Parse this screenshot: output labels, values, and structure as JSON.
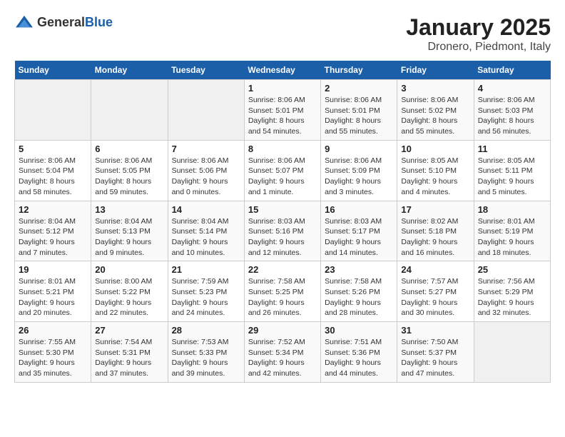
{
  "logo": {
    "text_general": "General",
    "text_blue": "Blue"
  },
  "title": "January 2025",
  "subtitle": "Dronero, Piedmont, Italy",
  "weekdays": [
    "Sunday",
    "Monday",
    "Tuesday",
    "Wednesday",
    "Thursday",
    "Friday",
    "Saturday"
  ],
  "weeks": [
    [
      {
        "day": "",
        "info": ""
      },
      {
        "day": "",
        "info": ""
      },
      {
        "day": "",
        "info": ""
      },
      {
        "day": "1",
        "info": "Sunrise: 8:06 AM\nSunset: 5:01 PM\nDaylight: 8 hours\nand 54 minutes."
      },
      {
        "day": "2",
        "info": "Sunrise: 8:06 AM\nSunset: 5:01 PM\nDaylight: 8 hours\nand 55 minutes."
      },
      {
        "day": "3",
        "info": "Sunrise: 8:06 AM\nSunset: 5:02 PM\nDaylight: 8 hours\nand 55 minutes."
      },
      {
        "day": "4",
        "info": "Sunrise: 8:06 AM\nSunset: 5:03 PM\nDaylight: 8 hours\nand 56 minutes."
      }
    ],
    [
      {
        "day": "5",
        "info": "Sunrise: 8:06 AM\nSunset: 5:04 PM\nDaylight: 8 hours\nand 58 minutes."
      },
      {
        "day": "6",
        "info": "Sunrise: 8:06 AM\nSunset: 5:05 PM\nDaylight: 8 hours\nand 59 minutes."
      },
      {
        "day": "7",
        "info": "Sunrise: 8:06 AM\nSunset: 5:06 PM\nDaylight: 9 hours\nand 0 minutes."
      },
      {
        "day": "8",
        "info": "Sunrise: 8:06 AM\nSunset: 5:07 PM\nDaylight: 9 hours\nand 1 minute."
      },
      {
        "day": "9",
        "info": "Sunrise: 8:06 AM\nSunset: 5:09 PM\nDaylight: 9 hours\nand 3 minutes."
      },
      {
        "day": "10",
        "info": "Sunrise: 8:05 AM\nSunset: 5:10 PM\nDaylight: 9 hours\nand 4 minutes."
      },
      {
        "day": "11",
        "info": "Sunrise: 8:05 AM\nSunset: 5:11 PM\nDaylight: 9 hours\nand 5 minutes."
      }
    ],
    [
      {
        "day": "12",
        "info": "Sunrise: 8:04 AM\nSunset: 5:12 PM\nDaylight: 9 hours\nand 7 minutes."
      },
      {
        "day": "13",
        "info": "Sunrise: 8:04 AM\nSunset: 5:13 PM\nDaylight: 9 hours\nand 9 minutes."
      },
      {
        "day": "14",
        "info": "Sunrise: 8:04 AM\nSunset: 5:14 PM\nDaylight: 9 hours\nand 10 minutes."
      },
      {
        "day": "15",
        "info": "Sunrise: 8:03 AM\nSunset: 5:16 PM\nDaylight: 9 hours\nand 12 minutes."
      },
      {
        "day": "16",
        "info": "Sunrise: 8:03 AM\nSunset: 5:17 PM\nDaylight: 9 hours\nand 14 minutes."
      },
      {
        "day": "17",
        "info": "Sunrise: 8:02 AM\nSunset: 5:18 PM\nDaylight: 9 hours\nand 16 minutes."
      },
      {
        "day": "18",
        "info": "Sunrise: 8:01 AM\nSunset: 5:19 PM\nDaylight: 9 hours\nand 18 minutes."
      }
    ],
    [
      {
        "day": "19",
        "info": "Sunrise: 8:01 AM\nSunset: 5:21 PM\nDaylight: 9 hours\nand 20 minutes."
      },
      {
        "day": "20",
        "info": "Sunrise: 8:00 AM\nSunset: 5:22 PM\nDaylight: 9 hours\nand 22 minutes."
      },
      {
        "day": "21",
        "info": "Sunrise: 7:59 AM\nSunset: 5:23 PM\nDaylight: 9 hours\nand 24 minutes."
      },
      {
        "day": "22",
        "info": "Sunrise: 7:58 AM\nSunset: 5:25 PM\nDaylight: 9 hours\nand 26 minutes."
      },
      {
        "day": "23",
        "info": "Sunrise: 7:58 AM\nSunset: 5:26 PM\nDaylight: 9 hours\nand 28 minutes."
      },
      {
        "day": "24",
        "info": "Sunrise: 7:57 AM\nSunset: 5:27 PM\nDaylight: 9 hours\nand 30 minutes."
      },
      {
        "day": "25",
        "info": "Sunrise: 7:56 AM\nSunset: 5:29 PM\nDaylight: 9 hours\nand 32 minutes."
      }
    ],
    [
      {
        "day": "26",
        "info": "Sunrise: 7:55 AM\nSunset: 5:30 PM\nDaylight: 9 hours\nand 35 minutes."
      },
      {
        "day": "27",
        "info": "Sunrise: 7:54 AM\nSunset: 5:31 PM\nDaylight: 9 hours\nand 37 minutes."
      },
      {
        "day": "28",
        "info": "Sunrise: 7:53 AM\nSunset: 5:33 PM\nDaylight: 9 hours\nand 39 minutes."
      },
      {
        "day": "29",
        "info": "Sunrise: 7:52 AM\nSunset: 5:34 PM\nDaylight: 9 hours\nand 42 minutes."
      },
      {
        "day": "30",
        "info": "Sunrise: 7:51 AM\nSunset: 5:36 PM\nDaylight: 9 hours\nand 44 minutes."
      },
      {
        "day": "31",
        "info": "Sunrise: 7:50 AM\nSunset: 5:37 PM\nDaylight: 9 hours\nand 47 minutes."
      },
      {
        "day": "",
        "info": ""
      }
    ]
  ]
}
